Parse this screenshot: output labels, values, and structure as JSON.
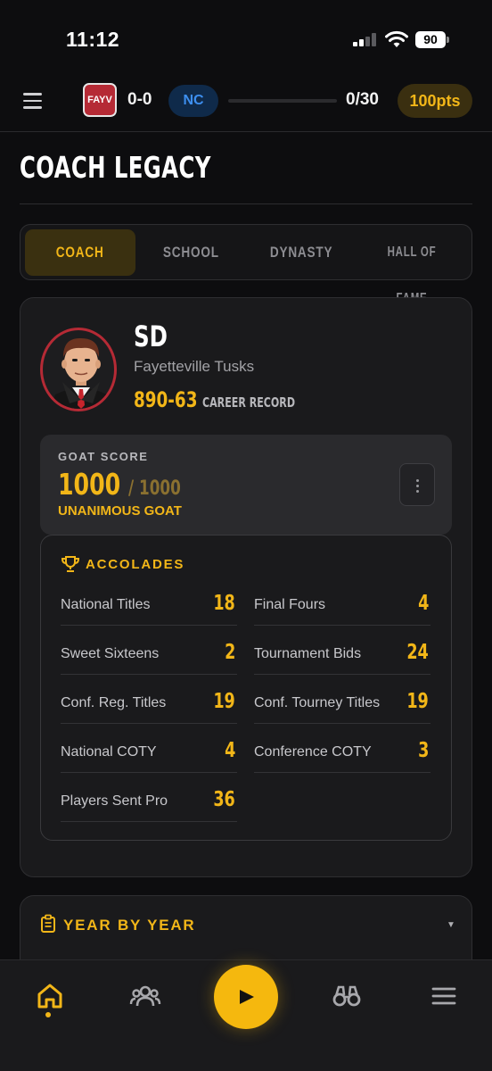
{
  "status_bar": {
    "time": "11:12",
    "battery": "90"
  },
  "top_bar": {
    "team_abbr": "FAYV",
    "team_record": "0-0",
    "conference": "NC",
    "progress": "0/30",
    "progress_fraction": 0.0,
    "points": "100pts"
  },
  "page": {
    "title": "COACH LEGACY"
  },
  "tabs": [
    {
      "label": "COACH",
      "active": true
    },
    {
      "label": "SCHOOL",
      "active": false
    },
    {
      "label": "DYNASTY",
      "active": false
    },
    {
      "label": "HALL OF FAME",
      "active": false
    }
  ],
  "coach": {
    "name": "SD",
    "team": "Fayetteville Tusks",
    "career_record": "890-63",
    "career_label": "CAREER RECORD"
  },
  "goat": {
    "label": "GOAT SCORE",
    "score": "1000",
    "max": "/ 1000",
    "title": "UNANIMOUS GOAT"
  },
  "accolades": {
    "title": "ACCOLADES",
    "items": [
      {
        "label": "National Titles",
        "value": "18"
      },
      {
        "label": "Final Fours",
        "value": "4"
      },
      {
        "label": "Sweet Sixteens",
        "value": "2"
      },
      {
        "label": "Tournament Bids",
        "value": "24"
      },
      {
        "label": "Conf. Reg. Titles",
        "value": "19"
      },
      {
        "label": "Conf. Tourney Titles",
        "value": "19"
      },
      {
        "label": "National COTY",
        "value": "4"
      },
      {
        "label": "Conference COTY",
        "value": "3"
      },
      {
        "label": "Players Sent Pro",
        "value": "36"
      }
    ]
  },
  "year_by_year": {
    "title": "YEAR BY YEAR"
  },
  "bottom_nav": {
    "items": [
      "home-icon",
      "team-icon",
      "play-icon",
      "scout-icon",
      "menu-icon"
    ],
    "active": "home-icon"
  },
  "colors": {
    "accent": "#f2b618",
    "team": "#b52a35",
    "conference": "#3d8ff0"
  }
}
